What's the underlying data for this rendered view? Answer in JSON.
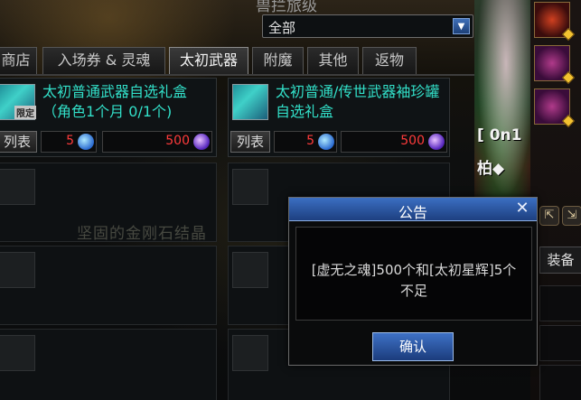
{
  "header": {
    "title": "兽拦旅级",
    "filter_value": "全部"
  },
  "tabs": [
    {
      "label": "商店",
      "active": false
    },
    {
      "label": "入场券 & 灵魂",
      "active": false
    },
    {
      "label": "太初武器",
      "active": true
    },
    {
      "label": "附魔",
      "active": false
    },
    {
      "label": "其他",
      "active": false
    },
    {
      "label": "返物",
      "active": false
    }
  ],
  "items": [
    {
      "name": "太初普通武器自选礼盒 （角色1个月 0/1个)",
      "tag": "限定",
      "list_label": "列表",
      "cost1": "5",
      "cost2": "500"
    },
    {
      "name": "太初普通/传世武器袖珍罐自选礼盒",
      "list_label": "列表",
      "cost1": "5",
      "cost2": "500"
    }
  ],
  "background_text": "坚固的金刚石结晶",
  "side": {
    "text1": "[ 0n1",
    "text2": "柏◆",
    "equip_tab": "装备",
    "mini_btn1": "⇱",
    "mini_btn2": "⇲"
  },
  "dialog": {
    "title": "公告",
    "close": "✕",
    "message": "[虚无之魂]500个和[太初星辉]5个不足",
    "ok_label": "确认"
  },
  "colors": {
    "item_name": "#32e0c9",
    "price": "#ff3b3b",
    "dialog_title_bar": "#3b6fc2"
  }
}
